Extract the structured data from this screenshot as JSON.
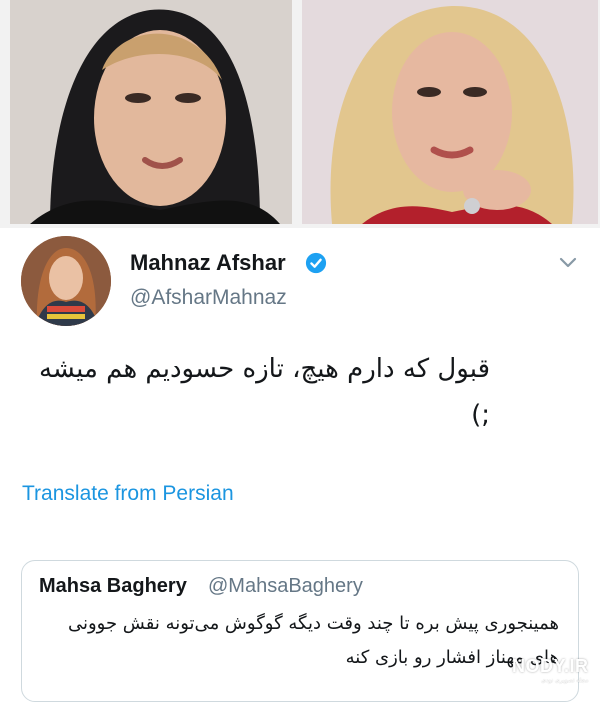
{
  "photos": {
    "left": {
      "icon": "portrait-photo-woman-headscarf"
    },
    "right": {
      "icon": "portrait-photo-woman-blonde"
    }
  },
  "tweet": {
    "avatar_icon": "profile-avatar",
    "display_name": "Mahnaz Afshar",
    "verified_icon": "verified-badge-icon",
    "handle": "@AfsharMahnaz",
    "menu_icon": "chevron-down-icon",
    "text": "قبول که دارم هیچ، تازه حسودیم هم میشه ;)",
    "translate_label": "Translate from Persian",
    "colors": {
      "link": "#1b95e0",
      "verified": "#1da1f2",
      "muted": "#657786"
    }
  },
  "quoted_tweet": {
    "display_name": "Mahsa Baghery",
    "handle": "@MahsaBaghery",
    "text": "همینجوری پیش بره تا چند وقت دیگه گوگوش می‌تونه نقش جوونی های مهناز افشار رو بازی کنه"
  },
  "watermark": {
    "text": "NODY.IR",
    "subtext": "مجله تصویری نودی"
  }
}
